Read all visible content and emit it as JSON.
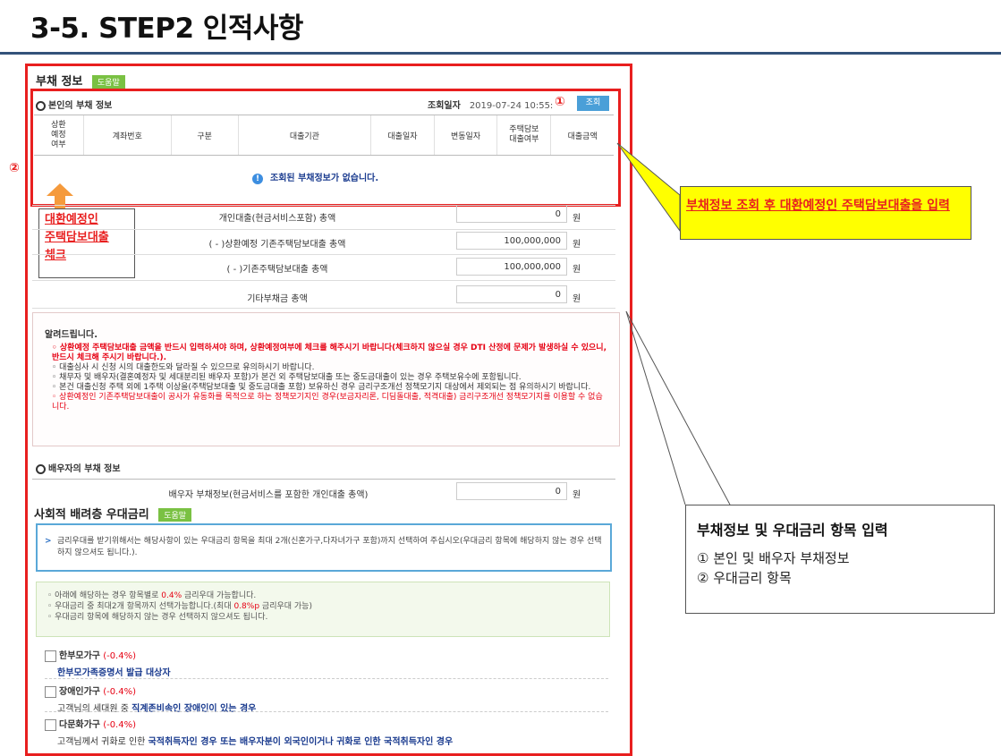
{
  "page": {
    "title": "3-5. STEP2 인적사항"
  },
  "debt": {
    "title": "부채 정보",
    "help_label": "도움말",
    "my_debt": {
      "title": "본인의 부채 정보",
      "query_date_label": "조회일자",
      "query_date": "2019-07-24 10:55:",
      "query_button": "조회",
      "columns": [
        "상환\n예정\n여부",
        "계좌번호",
        "구분",
        "대출기관",
        "대출일자",
        "변동일자",
        "주택담보\n대출여부",
        "대출금액"
      ],
      "empty_message": "조회된 부채정보가 없습니다."
    },
    "rows": [
      {
        "label": "개인대출(현금서비스포함) 총액",
        "value": "0",
        "unit": "원"
      },
      {
        "label": "( - )상환예정 기존주택담보대출 총액",
        "value": "100,000,000",
        "unit": "원"
      },
      {
        "label": "( - )기존주택담보대출 총액",
        "value": "100,000,000",
        "unit": "원"
      },
      {
        "label": "기타부채금 총액",
        "value": "0",
        "unit": "원"
      }
    ],
    "notice": {
      "title": "알려드립니다.",
      "items": [
        "상환예정 주택담보대출 금액을 반드시 입력하셔야 하며, 상환예정여부에 체크를 해주시기 바랍니다(체크하지 않으실 경우 DTI 산정에 문제가 발생하실 수 있으니, 반드시 체크해 주시기 바랍니다.).",
        "대출심사 시 신청 시의 대출한도와 달라질 수 있으므로 유의하시기 바랍니다.",
        "채무자 및 배우자(결혼예정자 및 세대분리된 배우자 포함)가 본건 외 주택담보대출 또는 중도금대출이 있는 경우 주택보유수에 포함됩니다.",
        "본건 대출신청 주택 외에 1주택 이상을(주택담보대출 및 중도금대출 포함) 보유하신 경우 금리구조개선 정책모기지 대상에서 제외되는 점 유의하시기 바랍니다.",
        "상환예정인 기존주택담보대출이 공사가 유동화를 목적으로 하는 정책모기지인 경우(보금자리론, 디딤돌대출, 적격대출) 금리구조개선 정책모기지를 이용할 수 없습니다."
      ]
    },
    "spouse": {
      "title": "배우자의 부채 정보",
      "label": "배우자 부채정보(현금서비스를 포함한 개인대출 총액)",
      "value": "0",
      "unit": "원"
    }
  },
  "preferential": {
    "title": "사회적 배려층 우대금리",
    "help_label": "도움말",
    "info": "금리우대를 받기위해서는 해당사항이 있는 우대금리 항목을 최대 2개(신혼가구,다자녀가구 포함)까지 선택하여 주십시오(우대금리 항목에 해당하지 않는 경우 선택하지 않으셔도 됩니다.).",
    "notes": [
      {
        "pre": "아래에 해당하는 경우 항목별로 ",
        "hl": "0.4%",
        "post": " 금리우대 가능합니다."
      },
      {
        "pre": "우대금리 중 최대2개 항목까지 선택가능합니다.(최대 ",
        "hl": "0.8%p",
        "post": " 금리우대 가능)"
      },
      {
        "pre": "우대금리 항목에 해당하지 않는 경우 선택하지 않으셔도 됩니다.",
        "hl": "",
        "post": ""
      }
    ],
    "items": [
      {
        "title": "한부모가구",
        "rate": "(-0.4%)",
        "desc_pre": "",
        "desc_bold": "한부모가족증명서 발급 대상자",
        "desc_post": ""
      },
      {
        "title": "장애인가구",
        "rate": "(-0.4%)",
        "desc_pre": "고객님의 세대원 중 ",
        "desc_bold": "직계존비속인 장애인이 있는 경우",
        "desc_post": ""
      },
      {
        "title": "다문화가구",
        "rate": "(-0.4%)",
        "desc_pre": "고객님께서 귀화로 인한 ",
        "desc_bold": "국적취득자인 경우 또는 배우자분이 외국인이거나 귀화로 인한 국적취득자인 경우",
        "desc_post": ""
      }
    ]
  },
  "annotations": {
    "marker1": "①",
    "marker2": "②",
    "orange_note": "대환예정인\n주택담보대출\n체크",
    "yellow_note": "부채정보 조회 후 대환예정인 주택담보대출을 입력",
    "callout_title": "부채정보 및 우대금리 항목 입력",
    "callout_lines": [
      "① 본인 및 배우자 부채정보",
      "② 우대금리 항목"
    ]
  },
  "colors": {
    "accent_red": "#e81f1f",
    "help_green": "#7ac143",
    "yellow_note": "#ffff00",
    "query_button": "#4a9fd8",
    "orange_arrow": "#f59a3c"
  }
}
